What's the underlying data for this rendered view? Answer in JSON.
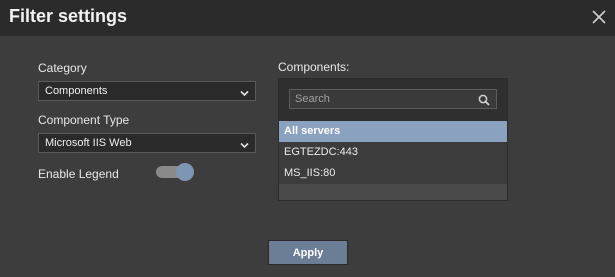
{
  "dialog": {
    "title": "Filter settings"
  },
  "category": {
    "label": "Category",
    "selected": "Components"
  },
  "component_type": {
    "label": "Component Type",
    "selected": "Microsoft IIS Web"
  },
  "legend": {
    "label": "Enable Legend",
    "enabled": true
  },
  "components": {
    "label": "Components:",
    "search_placeholder": "Search",
    "items": [
      {
        "label": "All servers",
        "selected": true
      },
      {
        "label": "EGTEZDC:443",
        "selected": false
      },
      {
        "label": "MS_IIS:80",
        "selected": false
      }
    ]
  },
  "actions": {
    "apply_label": "Apply"
  },
  "colors": {
    "accent": "#8aa1c0",
    "button": "#6c7e96",
    "header": "#2b2b2b",
    "background": "#3d3d3d"
  }
}
